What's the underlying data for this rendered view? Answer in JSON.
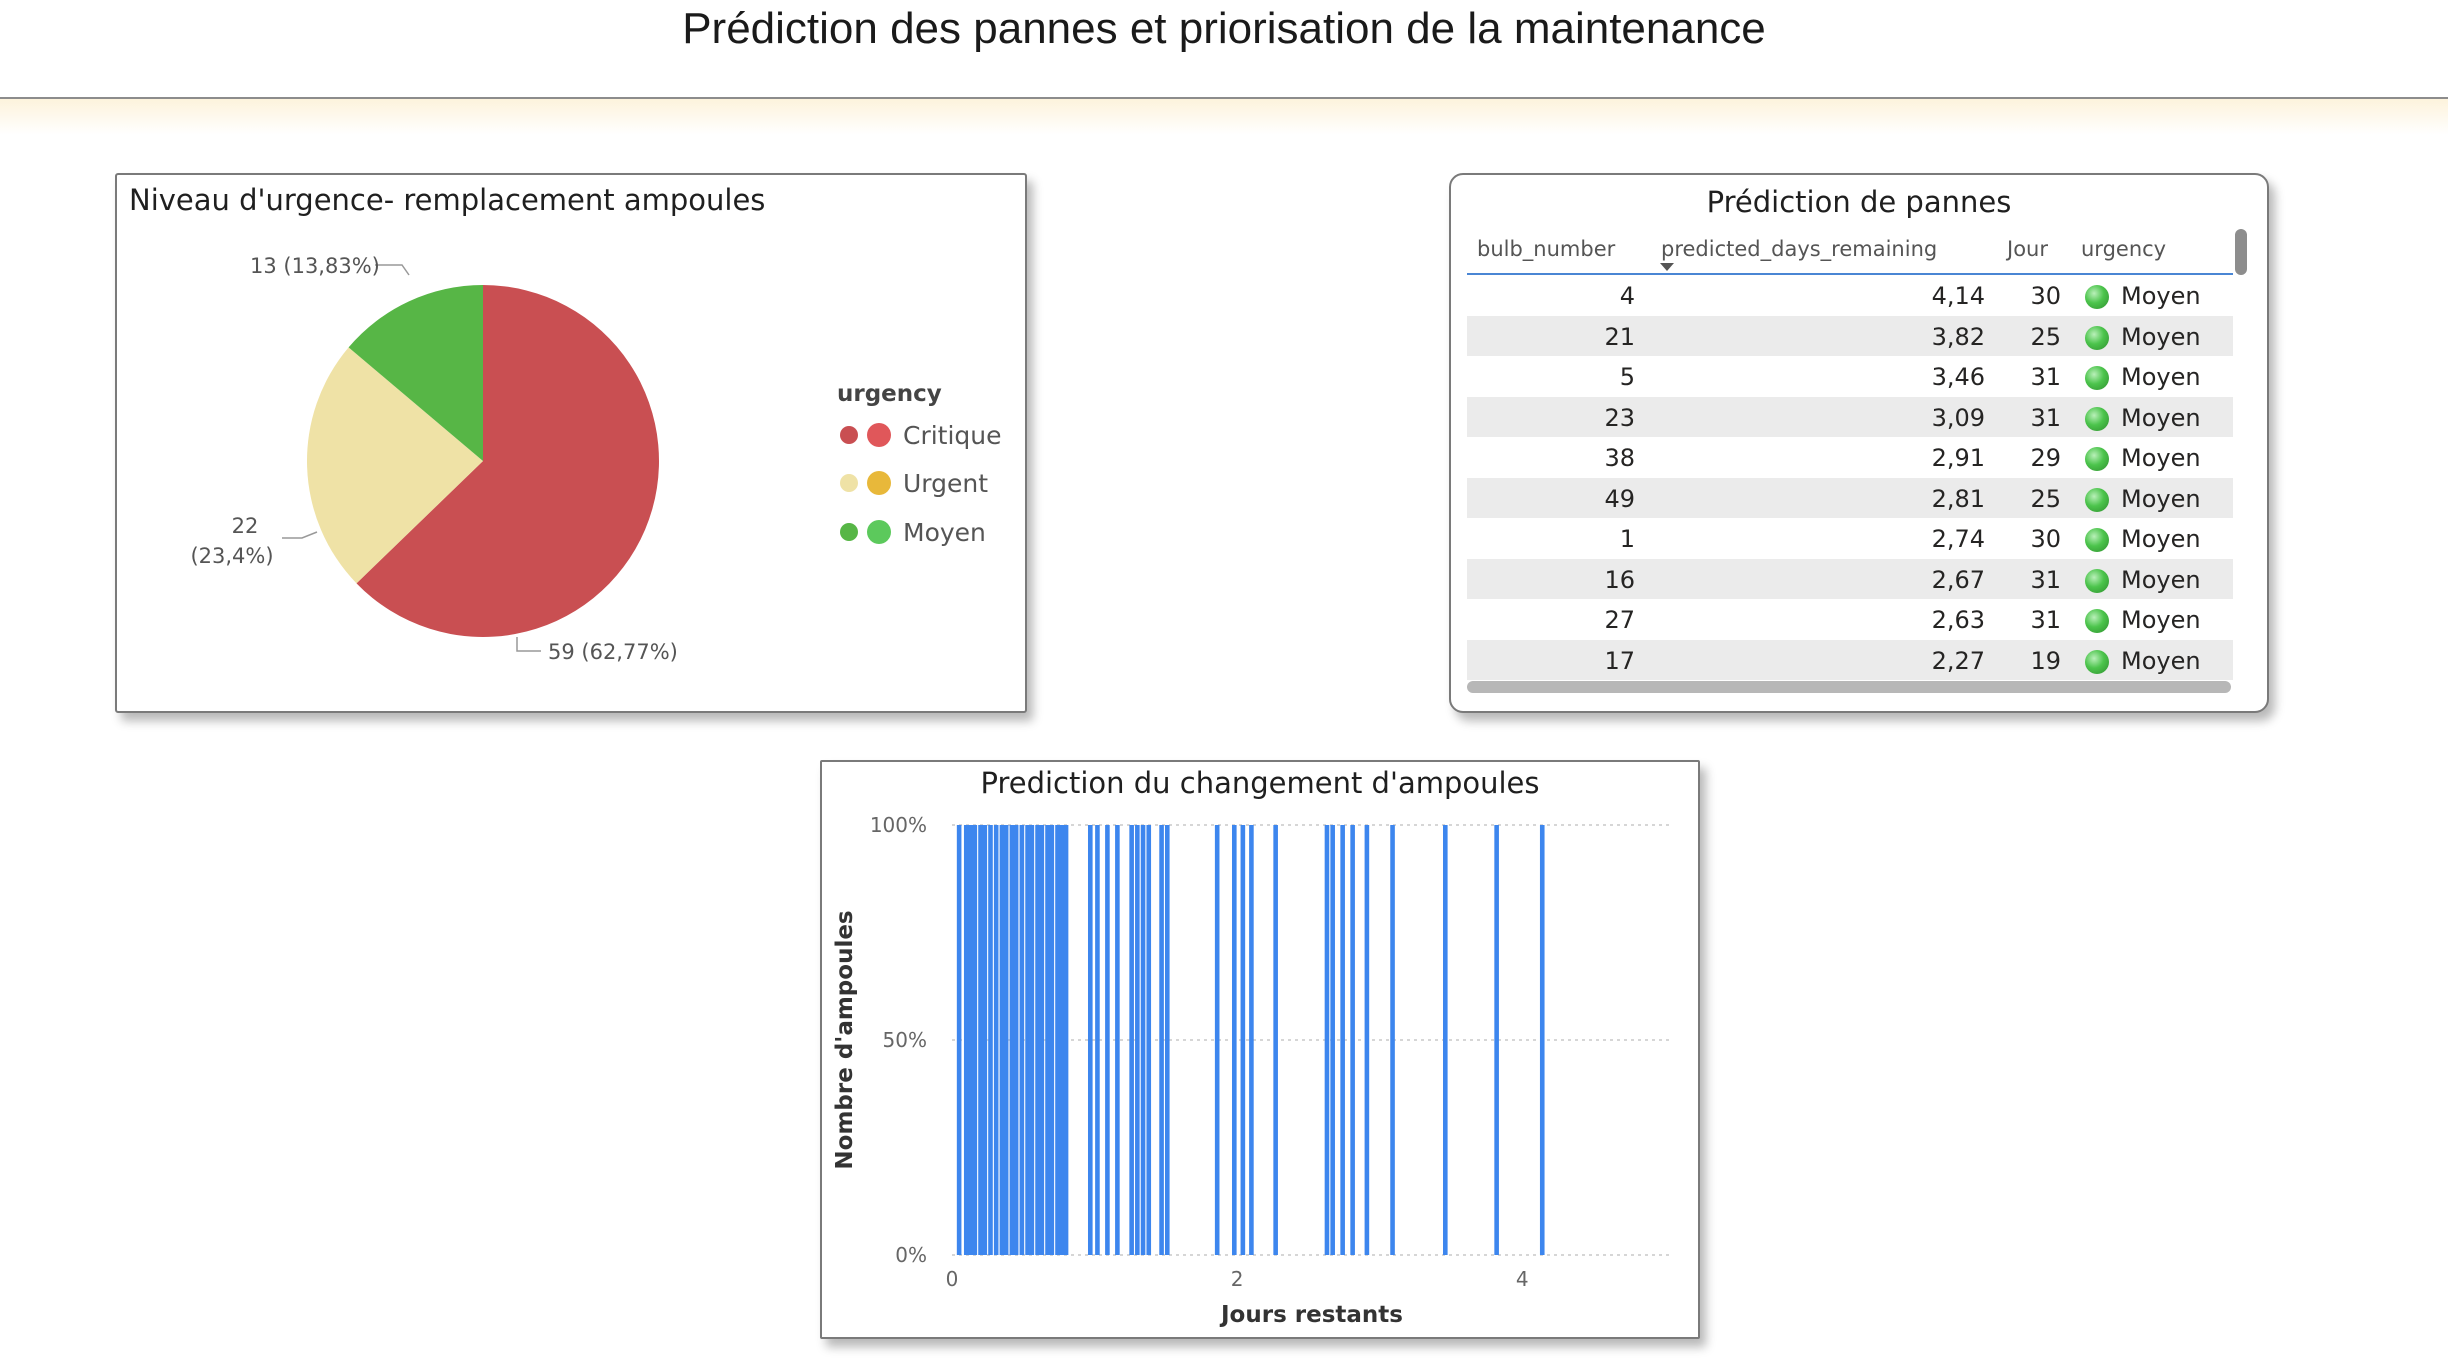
{
  "page": {
    "title": "Prédiction des pannes et priorisation de la maintenance"
  },
  "pie_card": {
    "title": "Niveau d'urgence- remplacement ampoules",
    "legend_title": "urgency",
    "slices": [
      {
        "name": "Critique",
        "value": 59,
        "label": "59 (62,77%)",
        "color": "#c94f52",
        "icon_color": "#e0575a"
      },
      {
        "name": "Urgent",
        "value": 22,
        "label_line1": "22",
        "label_line2": "(23,4%)",
        "color": "#efe2a6",
        "icon_color": "#e8b83a"
      },
      {
        "name": "Moyen",
        "value": 13,
        "label": "13 (13,83%)",
        "color": "#57b646",
        "icon_color": "#5cc95c"
      }
    ]
  },
  "table_card": {
    "title": "Prédiction de pannes",
    "columns": [
      "bulb_number",
      "predicted_days_remaining",
      "Jour",
      "urgency"
    ],
    "rows": [
      {
        "bulb_number": "4",
        "predicted_days_remaining": "4,14",
        "jour": "30",
        "urgency": "Moyen"
      },
      {
        "bulb_number": "21",
        "predicted_days_remaining": "3,82",
        "jour": "25",
        "urgency": "Moyen"
      },
      {
        "bulb_number": "5",
        "predicted_days_remaining": "3,46",
        "jour": "31",
        "urgency": "Moyen"
      },
      {
        "bulb_number": "23",
        "predicted_days_remaining": "3,09",
        "jour": "31",
        "urgency": "Moyen"
      },
      {
        "bulb_number": "38",
        "predicted_days_remaining": "2,91",
        "jour": "29",
        "urgency": "Moyen"
      },
      {
        "bulb_number": "49",
        "predicted_days_remaining": "2,81",
        "jour": "25",
        "urgency": "Moyen"
      },
      {
        "bulb_number": "1",
        "predicted_days_remaining": "2,74",
        "jour": "30",
        "urgency": "Moyen"
      },
      {
        "bulb_number": "16",
        "predicted_days_remaining": "2,67",
        "jour": "31",
        "urgency": "Moyen"
      },
      {
        "bulb_number": "27",
        "predicted_days_remaining": "2,63",
        "jour": "31",
        "urgency": "Moyen"
      },
      {
        "bulb_number": "17",
        "predicted_days_remaining": "2,27",
        "jour": "19",
        "urgency": "Moyen"
      }
    ],
    "sorted_by": "predicted_days_remaining",
    "sort_order": "descending"
  },
  "bar_card": {
    "title": "Prediction du changement d'ampoules"
  },
  "chart_data": {
    "type": "bar",
    "title": "Prediction du changement d'ampoules",
    "xlabel": "Jours restants",
    "ylabel": "Nombre d'ampoules",
    "x_ticks": [
      "0",
      "2",
      "4"
    ],
    "y_ticks": [
      "0%",
      "50%",
      "100%"
    ],
    "xlim": [
      0,
      5.05
    ],
    "ylim": [
      0,
      1
    ],
    "grid": true,
    "bar_color": "#3d86ee",
    "x": [
      0.05,
      0.1,
      0.13,
      0.16,
      0.2,
      0.23,
      0.27,
      0.31,
      0.35,
      0.38,
      0.42,
      0.45,
      0.49,
      0.53,
      0.56,
      0.6,
      0.63,
      0.67,
      0.7,
      0.74,
      0.77,
      0.8,
      0.97,
      1.02,
      1.09,
      1.16,
      1.26,
      1.3,
      1.34,
      1.38,
      1.47,
      1.51,
      1.86,
      1.98,
      2.04,
      2.1,
      2.27,
      2.63,
      2.67,
      2.74,
      2.81,
      2.91,
      3.09,
      3.46,
      3.82,
      4.14
    ],
    "values": [
      1,
      1,
      1,
      1,
      1,
      1,
      1,
      1,
      1,
      1,
      1,
      1,
      1,
      1,
      1,
      1,
      1,
      1,
      1,
      1,
      1,
      1,
      1,
      1,
      1,
      1,
      1,
      1,
      1,
      1,
      1,
      1,
      1,
      1,
      1,
      1,
      1,
      1,
      1,
      1,
      1,
      1,
      1,
      1,
      1,
      1
    ]
  },
  "colors": {
    "accent": "#4a86d4",
    "moyen_dot": "#4cc44c"
  }
}
